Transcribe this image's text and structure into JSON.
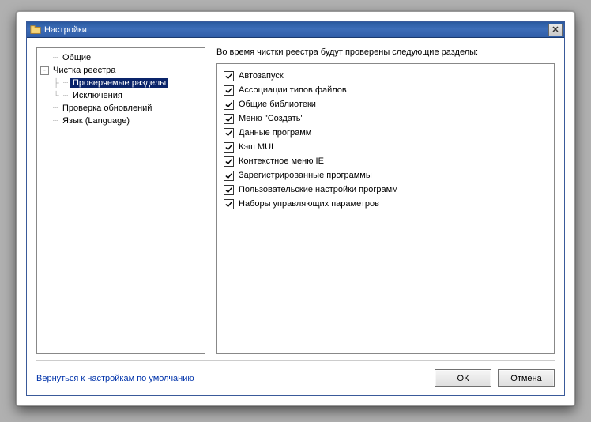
{
  "window": {
    "title": "Настройки"
  },
  "tree": {
    "general": "Общие",
    "registry_cleanup": "Чистка реестра",
    "checked_sections": "Проверяемые разделы",
    "exclusions": "Исключения",
    "check_updates": "Проверка обновлений",
    "language": "Язык (Language)"
  },
  "right": {
    "heading": "Во время чистки реестра будут проверены следующие разделы:",
    "items": [
      "Автозапуск",
      "Ассоциации типов файлов",
      "Общие библиотеки",
      "Меню \"Создать\"",
      "Данные программ",
      "Кэш MUI",
      "Контекстное меню IE",
      "Зарегистрированные программы",
      "Пользовательские настройки программ",
      "Наборы управляющих параметров"
    ]
  },
  "footer": {
    "reset_link": "Вернуться к настройкам по умолчанию",
    "ok": "ОК",
    "cancel": "Отмена"
  }
}
